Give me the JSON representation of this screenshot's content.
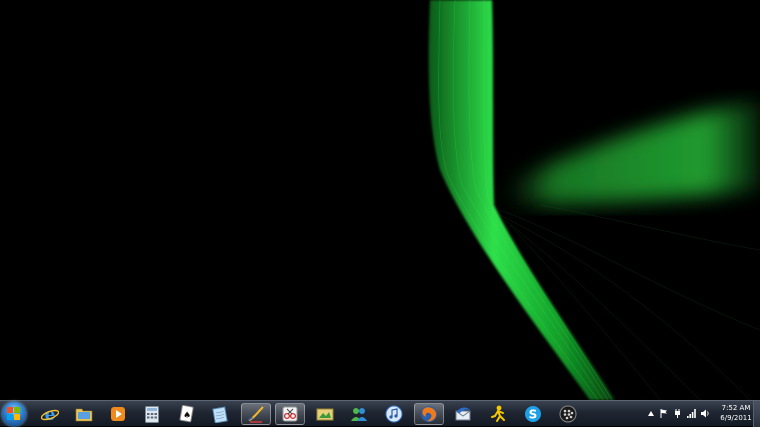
{
  "desktop": {
    "wallpaper": "green-wave-black"
  },
  "taskbar": {
    "pinned": [
      {
        "id": "internet-explorer",
        "icon": "internet-explorer-icon",
        "active": false
      },
      {
        "id": "file-explorer",
        "icon": "folder-icon",
        "active": false
      },
      {
        "id": "media-player",
        "icon": "media-player-icon",
        "active": false
      },
      {
        "id": "calculator",
        "icon": "calculator-icon",
        "active": false
      },
      {
        "id": "solitaire",
        "icon": "card-game-icon",
        "active": false
      },
      {
        "id": "notepad",
        "icon": "notepad-icon",
        "active": false
      },
      {
        "id": "paint-app",
        "icon": "paint-brush-icon",
        "active": true
      },
      {
        "id": "snipping-tool",
        "icon": "scissors-icon",
        "active": true
      },
      {
        "id": "photo-gallery",
        "icon": "photo-gallery-icon",
        "active": false
      },
      {
        "id": "messenger",
        "icon": "messenger-people-icon",
        "active": false
      },
      {
        "id": "itunes",
        "icon": "music-note-icon",
        "active": false
      },
      {
        "id": "firefox",
        "icon": "firefox-icon",
        "active": true
      },
      {
        "id": "thunderbird",
        "icon": "mail-bird-icon",
        "active": false
      },
      {
        "id": "yahoo-messenger",
        "icon": "running-man-icon",
        "active": false
      },
      {
        "id": "skype",
        "icon": "skype-icon",
        "active": false
      },
      {
        "id": "blackberry",
        "icon": "blackberry-icon",
        "active": false
      }
    ],
    "tray": {
      "clock_time": "7:52 AM",
      "clock_date": "6/9/2011"
    }
  },
  "colors": {
    "accent_green": "#22c83a",
    "taskbar": "#1f2632"
  }
}
